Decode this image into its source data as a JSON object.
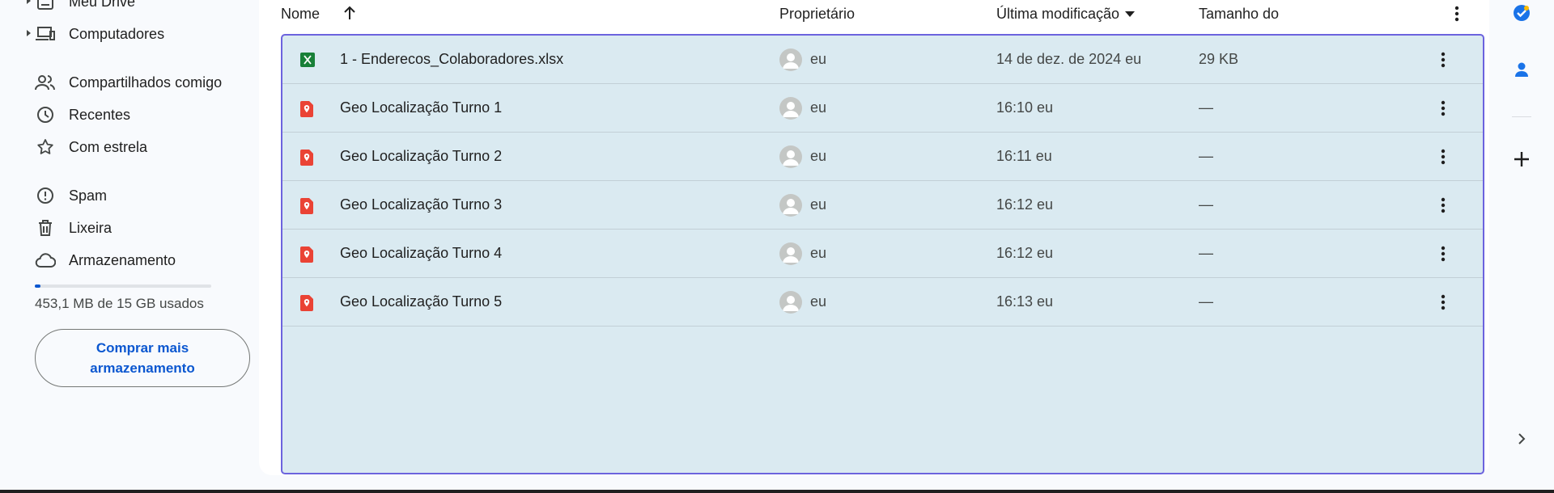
{
  "sidebar": {
    "items": [
      {
        "label": "Meu Drive",
        "icon": "drive-icon"
      },
      {
        "label": "Computadores",
        "icon": "computers-icon"
      },
      {
        "label": "Compartilhados comigo",
        "icon": "people-icon"
      },
      {
        "label": "Recentes",
        "icon": "clock-icon"
      },
      {
        "label": "Com estrela",
        "icon": "star-icon"
      },
      {
        "label": "Spam",
        "icon": "spam-icon"
      },
      {
        "label": "Lixeira",
        "icon": "trash-icon"
      },
      {
        "label": "Armazenamento",
        "icon": "cloud-icon"
      }
    ],
    "storage": {
      "text": "453,1 MB de 15 GB usados",
      "used_fraction": 0.03
    },
    "buy_button": "Comprar mais armazenamento"
  },
  "table": {
    "headers": {
      "name": "Nome",
      "owner": "Proprietário",
      "modified": "Última modificação",
      "size": "Tamanho do"
    },
    "rows": [
      {
        "name": "1 - Enderecos_Colaboradores.xlsx",
        "type": "excel",
        "owner": "eu",
        "modified": "14 de dez. de 2024 eu",
        "size": "29 KB"
      },
      {
        "name": "Geo Localização Turno 1",
        "type": "mymaps",
        "owner": "eu",
        "modified": "16:10 eu",
        "size": "—"
      },
      {
        "name": "Geo Localização Turno 2",
        "type": "mymaps",
        "owner": "eu",
        "modified": "16:11 eu",
        "size": "—"
      },
      {
        "name": "Geo Localização Turno 3",
        "type": "mymaps",
        "owner": "eu",
        "modified": "16:12 eu",
        "size": "—"
      },
      {
        "name": "Geo Localização Turno 4",
        "type": "mymaps",
        "owner": "eu",
        "modified": "16:12 eu",
        "size": "—"
      },
      {
        "name": "Geo Localização Turno 5",
        "type": "mymaps",
        "owner": "eu",
        "modified": "16:13 eu",
        "size": "—"
      }
    ]
  },
  "rail": {
    "icons": [
      "tasks-icon",
      "contacts-icon",
      "add-icon",
      "expand-panel-icon"
    ]
  },
  "colors": {
    "accent": "#0b57d0",
    "selection_bg": "#daeaf1",
    "selection_border": "#6c63de",
    "excel_green": "#188038",
    "maps_red": "#ea4335"
  }
}
